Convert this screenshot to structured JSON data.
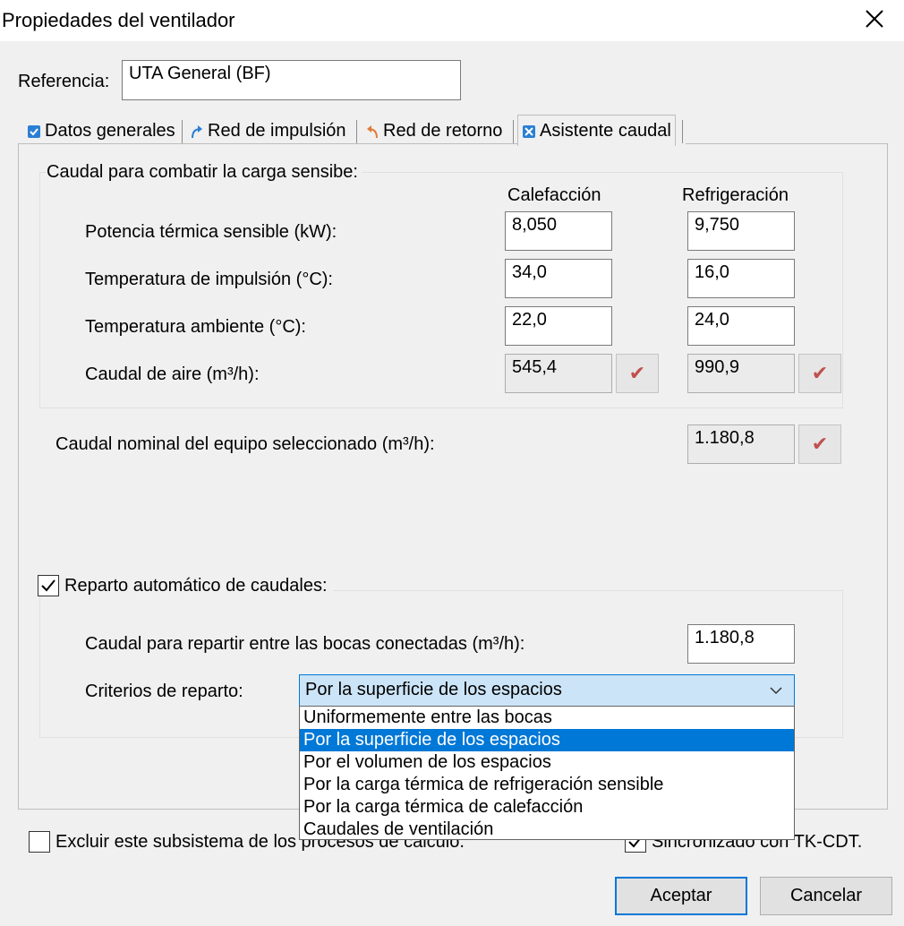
{
  "window": {
    "title": "Propiedades del ventilador"
  },
  "reference": {
    "label": "Referencia:",
    "value": "UTA General (BF)"
  },
  "tabs": [
    {
      "label": "Datos generales",
      "icon": "checkbox-blue-icon"
    },
    {
      "label": "Red de impulsión",
      "icon": "arrow-curved-blue-icon"
    },
    {
      "label": "Red de retorno",
      "icon": "arrow-return-orange-icon"
    },
    {
      "label": "Asistente caudal",
      "icon": "wizard-icon",
      "active": true
    }
  ],
  "sensible": {
    "title": "Caudal para combatir la carga sensibe:",
    "col_heating": "Calefacción",
    "col_cooling": "Refrigeración",
    "rows": [
      {
        "label": "Potencia térmica sensible (kW):",
        "heating": "8,050",
        "cooling": "9,750"
      },
      {
        "label": "Temperatura de impulsión (°C):",
        "heating": "34,0",
        "cooling": "16,0"
      },
      {
        "label": "Temperatura ambiente (°C):",
        "heating": "22,0",
        "cooling": "24,0"
      },
      {
        "label": "Caudal de aire (m³/h):",
        "heating": "545,4",
        "cooling": "990,9"
      }
    ]
  },
  "nominal": {
    "label": "Caudal nominal del equipo seleccionado (m³/h):",
    "value": "1.180,8"
  },
  "reparto": {
    "checkbox_label": "Reparto automático de caudales:",
    "checked": true,
    "caudal_label": "Caudal para repartir entre las bocas conectadas (m³/h):",
    "caudal_value": "1.180,8",
    "criterio_label": "Criterios de reparto:",
    "criterio_selected": "Por la superficie de los espacios",
    "options": [
      "Uniformemente entre las bocas",
      "Por la superficie de los espacios",
      "Por el volumen de los espacios",
      "Por la carga térmica de refrigeración sensible",
      "Por la carga térmica de calefacción",
      "Caudales de ventilación"
    ]
  },
  "footer": {
    "exclude_label": "Excluir este subsistema de los procesos de cálculo.",
    "sync_label": "Sincronizado con TK-CDT.",
    "accept": "Aceptar",
    "cancel": "Cancelar"
  },
  "colors": {
    "accent": "#0078d7",
    "check_mark": "#c0504d",
    "selection_bg": "#cce4f7"
  }
}
